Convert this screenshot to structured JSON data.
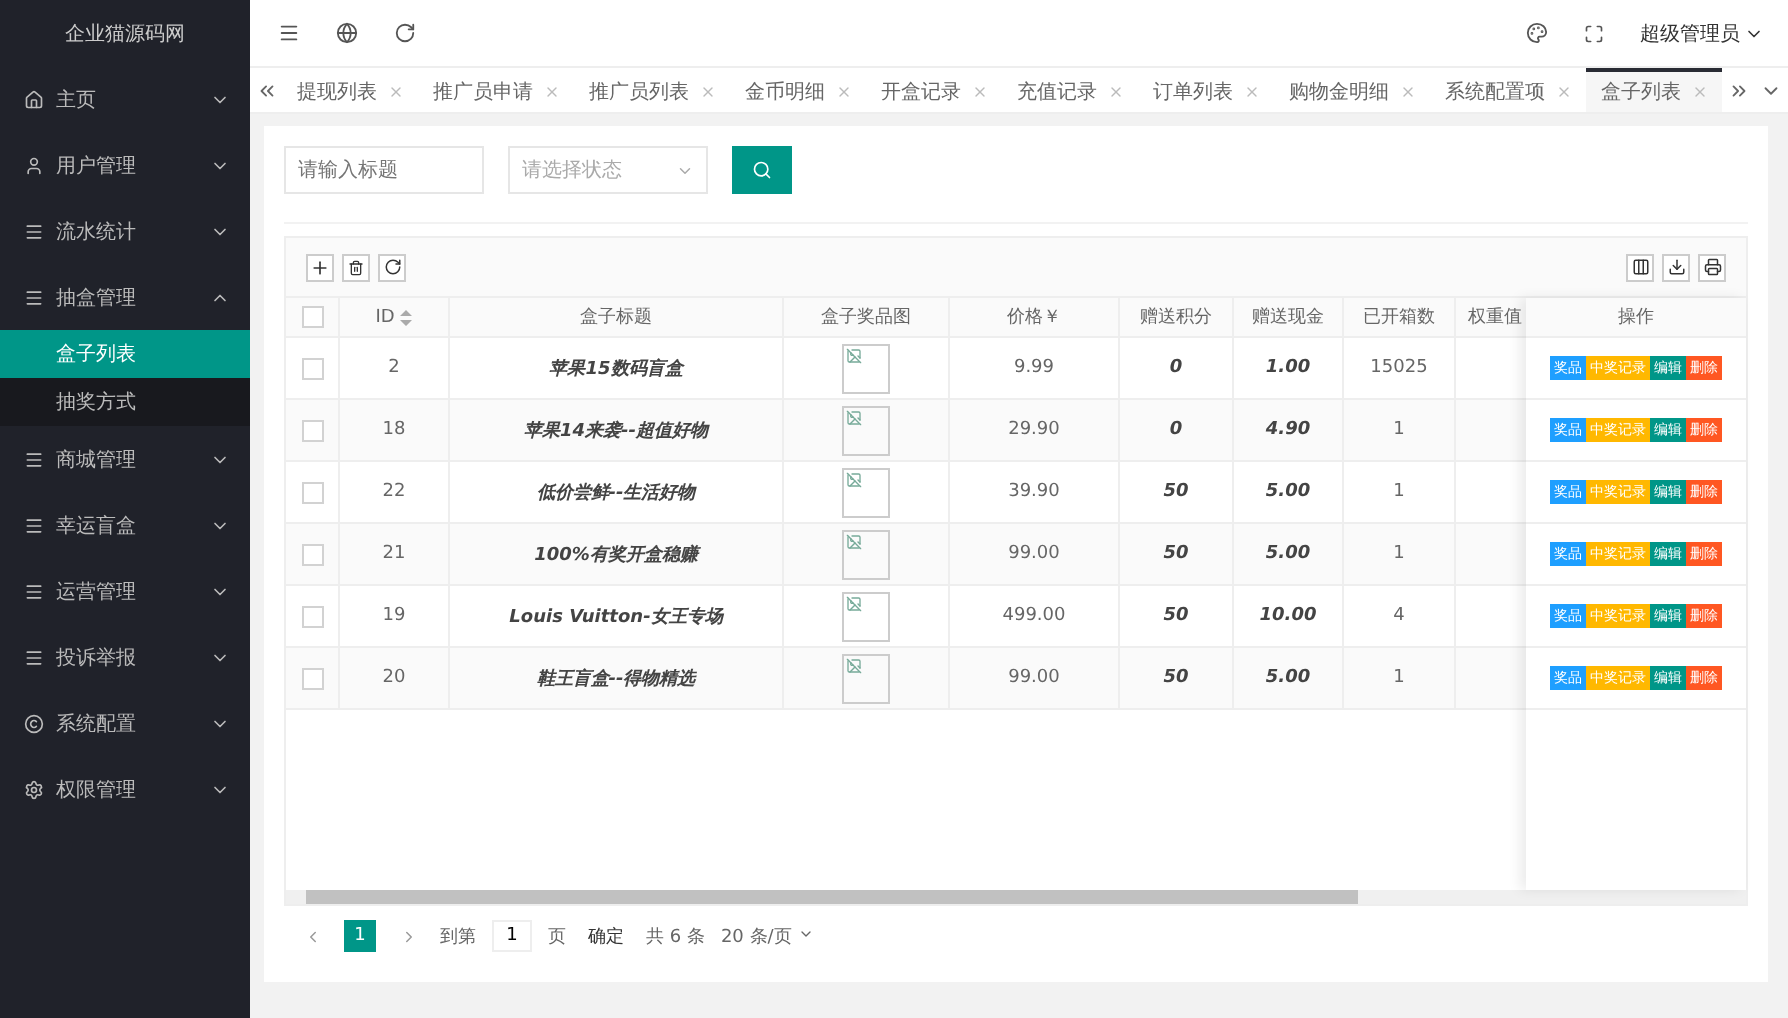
{
  "logo": "企业猫源码网",
  "sidebar": {
    "items": [
      {
        "label": "主页",
        "expanded": false
      },
      {
        "label": "用户管理",
        "expanded": false
      },
      {
        "label": "流水统计",
        "expanded": false
      },
      {
        "label": "抽盒管理",
        "expanded": true,
        "children": [
          {
            "label": "盒子列表",
            "selected": true
          },
          {
            "label": "抽奖方式",
            "selected": false
          }
        ]
      },
      {
        "label": "商城管理",
        "expanded": false
      },
      {
        "label": "幸运盲盒",
        "expanded": false
      },
      {
        "label": "运营管理",
        "expanded": false
      },
      {
        "label": "投诉举报",
        "expanded": false
      },
      {
        "label": "系统配置",
        "expanded": false
      },
      {
        "label": "权限管理",
        "expanded": false
      }
    ]
  },
  "user": "超级管理员",
  "tabs": [
    {
      "label": "提现列表",
      "selected": false
    },
    {
      "label": "推广员申请",
      "selected": false
    },
    {
      "label": "推广员列表",
      "selected": false
    },
    {
      "label": "金币明细",
      "selected": false
    },
    {
      "label": "开盒记录",
      "selected": false
    },
    {
      "label": "充值记录",
      "selected": false
    },
    {
      "label": "订单列表",
      "selected": false
    },
    {
      "label": "购物金明细",
      "selected": false
    },
    {
      "label": "系统配置项",
      "selected": false
    },
    {
      "label": "盒子列表",
      "selected": true
    }
  ],
  "search": {
    "title_placeholder": "请输入标题",
    "status_placeholder": "请选择状态"
  },
  "table": {
    "all_checked": false,
    "headers": {
      "id": "ID",
      "title": "盒子标题",
      "image": "盒子奖品图",
      "price": "价格￥",
      "points": "赠送积分",
      "cash": "赠送现金",
      "opened": "已开箱数",
      "weight": "权重值",
      "actions": "操作"
    },
    "rows": [
      {
        "checked": false,
        "id": "2",
        "title": "苹果15数码盲盒",
        "price": "9.99",
        "points": "0",
        "cash": "1.00",
        "opened": "15025",
        "actions": [
          "奖品",
          "中奖记录",
          "编辑",
          "删除"
        ]
      },
      {
        "checked": false,
        "id": "18",
        "title": "苹果14来袭--超值好物",
        "price": "29.90",
        "points": "0",
        "cash": "4.90",
        "opened": "1",
        "actions": [
          "奖品",
          "中奖记录",
          "编辑",
          "删除"
        ]
      },
      {
        "checked": false,
        "id": "22",
        "title": "低价尝鲜--生活好物",
        "price": "39.90",
        "points": "50",
        "cash": "5.00",
        "opened": "1",
        "actions": [
          "奖品",
          "中奖记录",
          "编辑",
          "删除"
        ]
      },
      {
        "checked": false,
        "id": "21",
        "title": "100%有奖开盒稳赚",
        "price": "99.00",
        "points": "50",
        "cash": "5.00",
        "opened": "1",
        "actions": [
          "奖品",
          "中奖记录",
          "编辑",
          "删除"
        ]
      },
      {
        "checked": false,
        "id": "19",
        "title": "Louis Vuitton-女王专场",
        "price": "499.00",
        "points": "50",
        "cash": "10.00",
        "opened": "4",
        "actions": [
          "奖品",
          "中奖记录",
          "编辑",
          "删除"
        ]
      },
      {
        "checked": false,
        "id": "20",
        "title": "鞋王盲盒--得物精选",
        "price": "99.00",
        "points": "50",
        "cash": "5.00",
        "opened": "1",
        "actions": [
          "奖品",
          "中奖记录",
          "编辑",
          "删除"
        ]
      }
    ]
  },
  "pagination": {
    "current": "1",
    "goto_label": "到第",
    "page_value": "1",
    "page_label": "页",
    "confirm": "确定",
    "total": "共 6 条",
    "page_size": "20 条/页"
  }
}
